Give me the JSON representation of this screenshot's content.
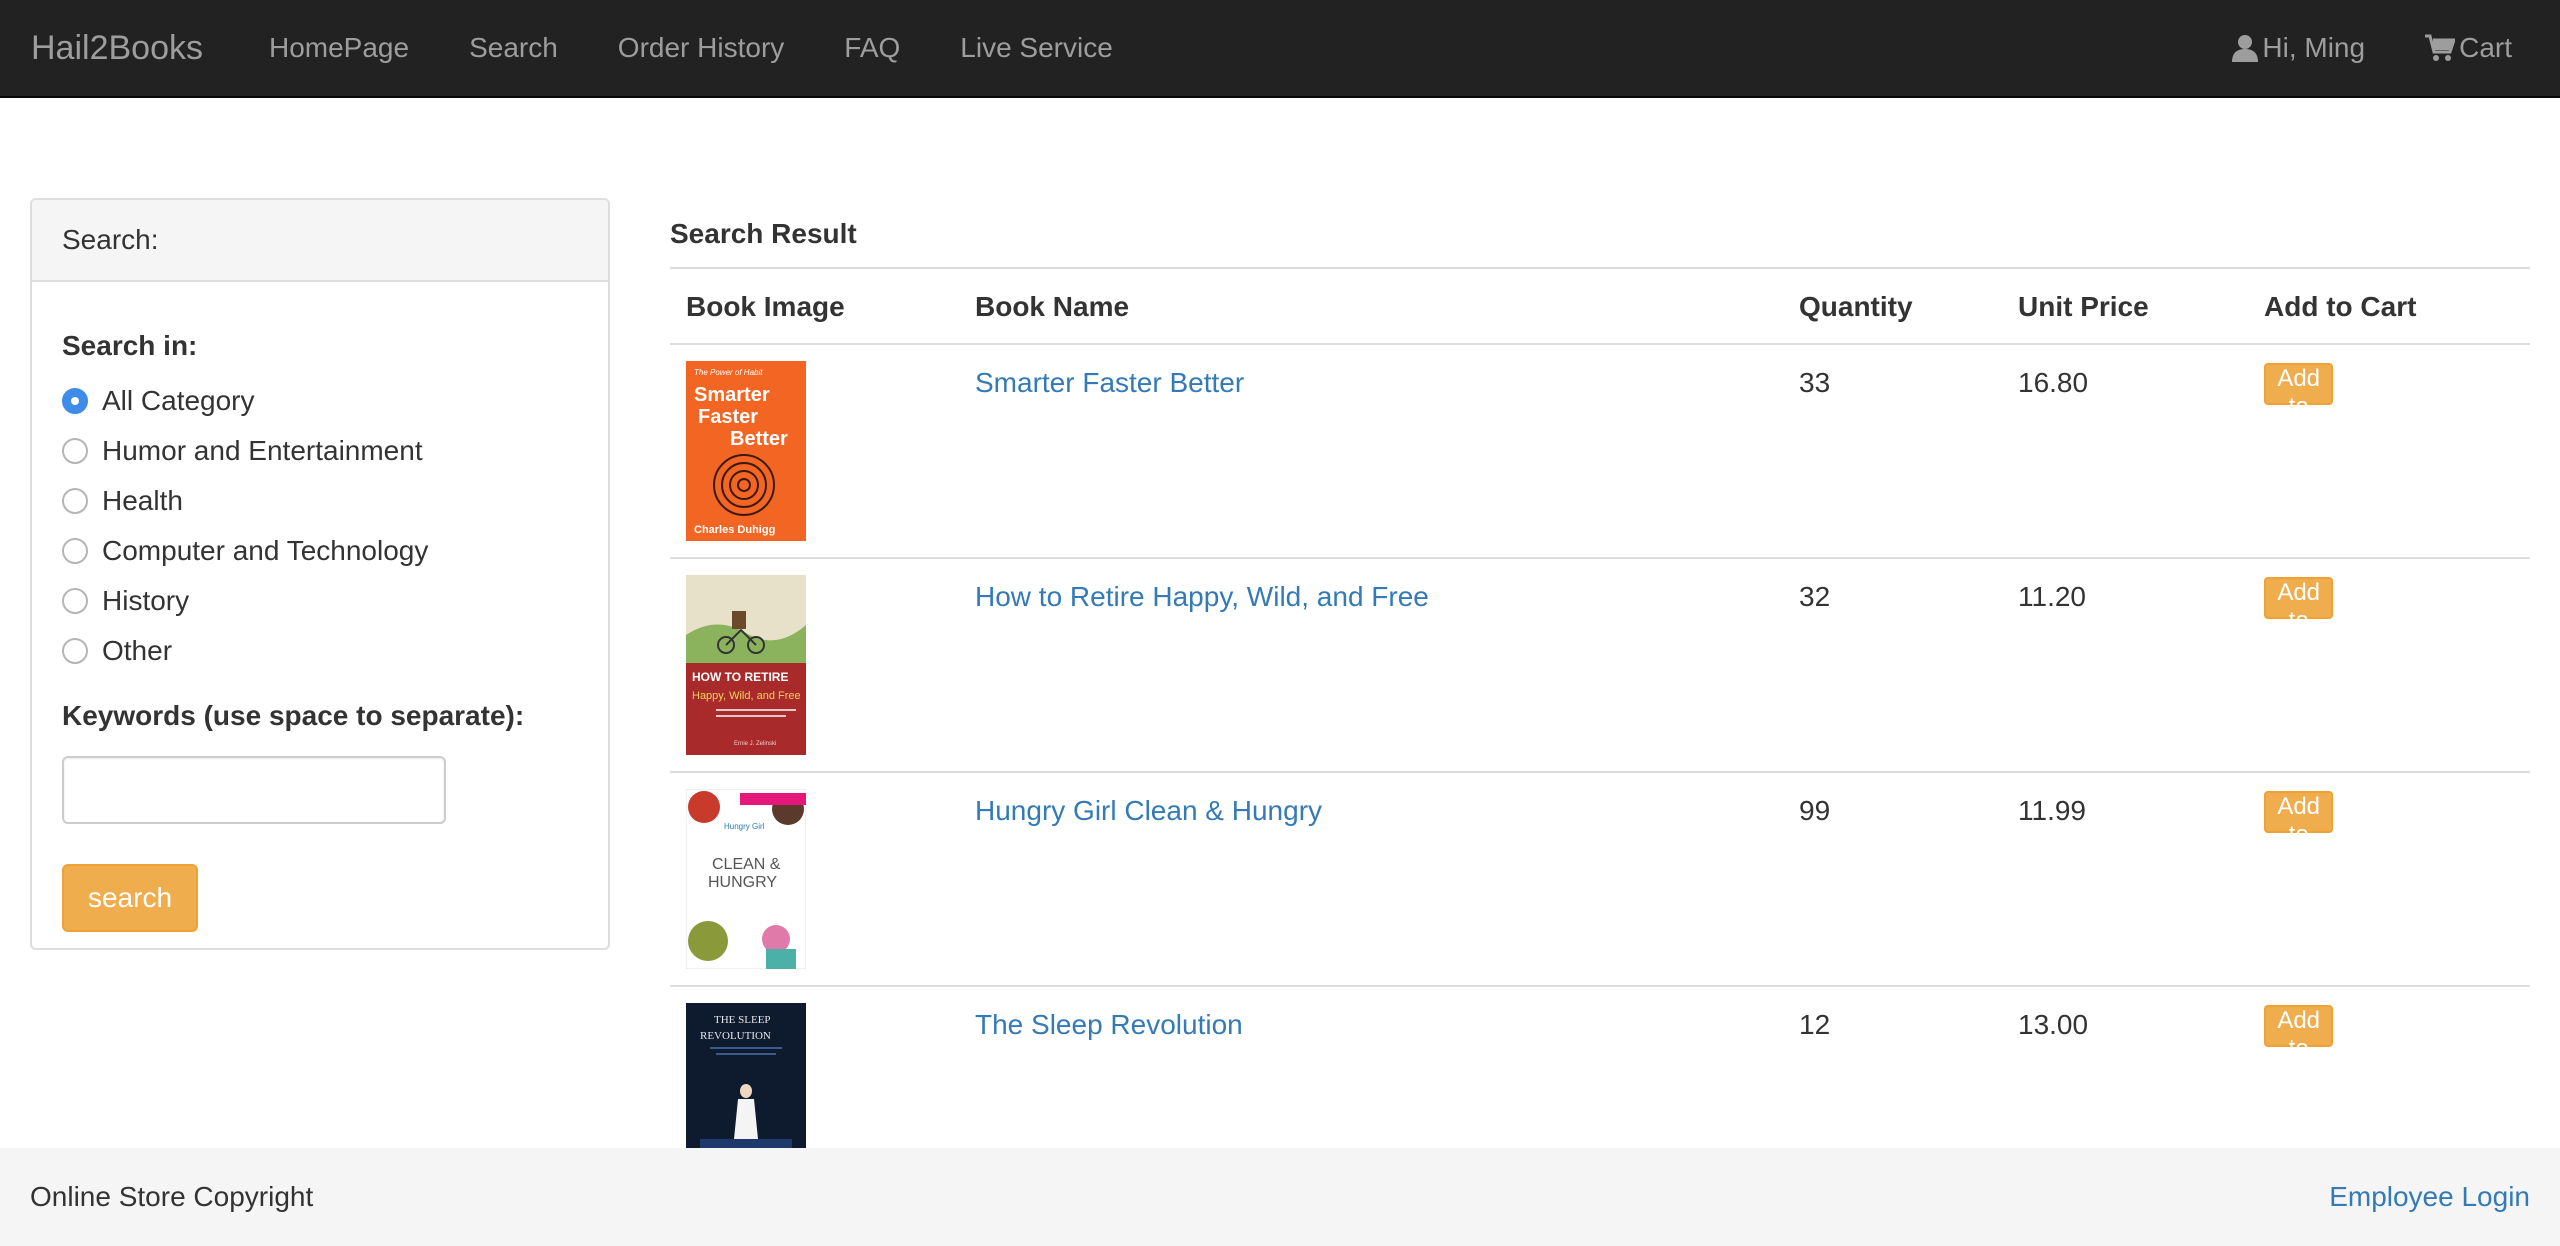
{
  "navbar": {
    "brand": "Hail2Books",
    "links": [
      "HomePage",
      "Search",
      "Order History",
      "FAQ",
      "Live Service"
    ],
    "user_label": "Hi, Ming",
    "cart_label": "Cart"
  },
  "sidebar": {
    "heading": "Search:",
    "search_in_label": "Search in:",
    "categories": [
      {
        "label": "All Category",
        "selected": true
      },
      {
        "label": "Humor and Entertainment",
        "selected": false
      },
      {
        "label": "Health",
        "selected": false
      },
      {
        "label": "Computer and Technology",
        "selected": false
      },
      {
        "label": "History",
        "selected": false
      },
      {
        "label": "Other",
        "selected": false
      }
    ],
    "keywords_label": "Keywords (use space to separate):",
    "keywords_value": "",
    "search_button": "search"
  },
  "results": {
    "title": "Search Result",
    "columns": [
      "Book Image",
      "Book Name",
      "Quantity",
      "Unit Price",
      "Add to Cart"
    ],
    "rows": [
      {
        "name": "Smarter Faster Better",
        "quantity": "33",
        "price": "16.80",
        "button": "Add to Cart"
      },
      {
        "name": "How to Retire Happy, Wild, and Free",
        "quantity": "32",
        "price": "11.20",
        "button": "Add to Cart"
      },
      {
        "name": "Hungry Girl Clean & Hungry",
        "quantity": "99",
        "price": "11.99",
        "button": "Add to Cart"
      },
      {
        "name": "The Sleep Revolution",
        "quantity": "12",
        "price": "13.00",
        "button": "Add to Cart"
      }
    ],
    "covers": [
      {
        "top": "The Power of Habit",
        "lines": [
          "Smarter",
          "Faster",
          "Better"
        ],
        "author": "Charles Duhigg"
      },
      {
        "lines": [
          "HOW TO RETIRE",
          "Happy, Wild, and Free"
        ],
        "author": "Ernie J. Zelinski"
      },
      {
        "lines": [
          "CLEAN &",
          "HUNGRY"
        ],
        "top": "Hungry Girl"
      },
      {
        "lines": [
          "THE SLEEP",
          "REVOLUTION"
        ]
      }
    ]
  },
  "footer": {
    "copyright": "Online Store Copyright",
    "employee_login": "Employee Login"
  },
  "colors": {
    "navbar_bg": "#222222",
    "nav_text": "#9d9d9d",
    "link_blue": "#337ab7",
    "warning_orange": "#f0ad4e",
    "radio_blue": "#3e8bea"
  }
}
